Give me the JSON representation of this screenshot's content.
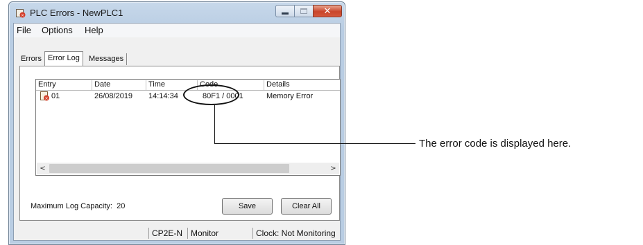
{
  "window": {
    "title": "PLC Errors - NewPLC1"
  },
  "menu": [
    "File",
    "Options",
    "Help"
  ],
  "tabs": [
    "Errors",
    "Error Log",
    "Messages"
  ],
  "list": {
    "columns": [
      "Entry",
      "Date",
      "Time",
      "Code",
      "Details"
    ],
    "row": {
      "entry": "01",
      "date": "26/08/2019",
      "time": "14:14:34",
      "code": "80F1 / 0001",
      "details": "Memory Error"
    }
  },
  "capacity": {
    "label": "Maximum Log Capacity:",
    "value": "20"
  },
  "buttons": {
    "save": "Save",
    "clear": "Clear All"
  },
  "status": {
    "model": "CP2E-N",
    "mode": "Monitor",
    "clock": "Clock: Not Monitoring"
  },
  "annotation": {
    "text": "The error code is displayed here."
  },
  "icons": {
    "title": "plc-error-icon",
    "entry": "error-entry-icon"
  }
}
